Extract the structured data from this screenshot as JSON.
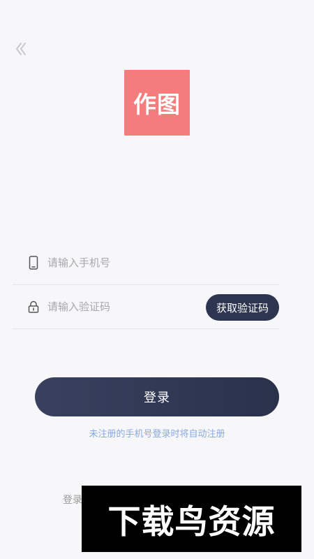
{
  "navigation": {
    "back_icon": "chevron-left-icon"
  },
  "brand": {
    "logo_text": "作图",
    "logo_color": "#f47c7c"
  },
  "form": {
    "phone": {
      "placeholder": "请输入手机号",
      "icon": "phone-icon",
      "value": ""
    },
    "code": {
      "placeholder": "请输入验证码",
      "icon": "lock-icon",
      "value": ""
    },
    "get_code_label": "获取验证码",
    "login_label": "登录",
    "auto_register_notice": "未注册的手机号登录时将自动注册"
  },
  "footer": {
    "agreement_prefix": "登录"
  },
  "watermark": {
    "text": "下载鸟资源"
  },
  "colors": {
    "accent_dark": "#2d3550",
    "notice_blue": "#8aa9df",
    "background": "#f7f7f9"
  }
}
